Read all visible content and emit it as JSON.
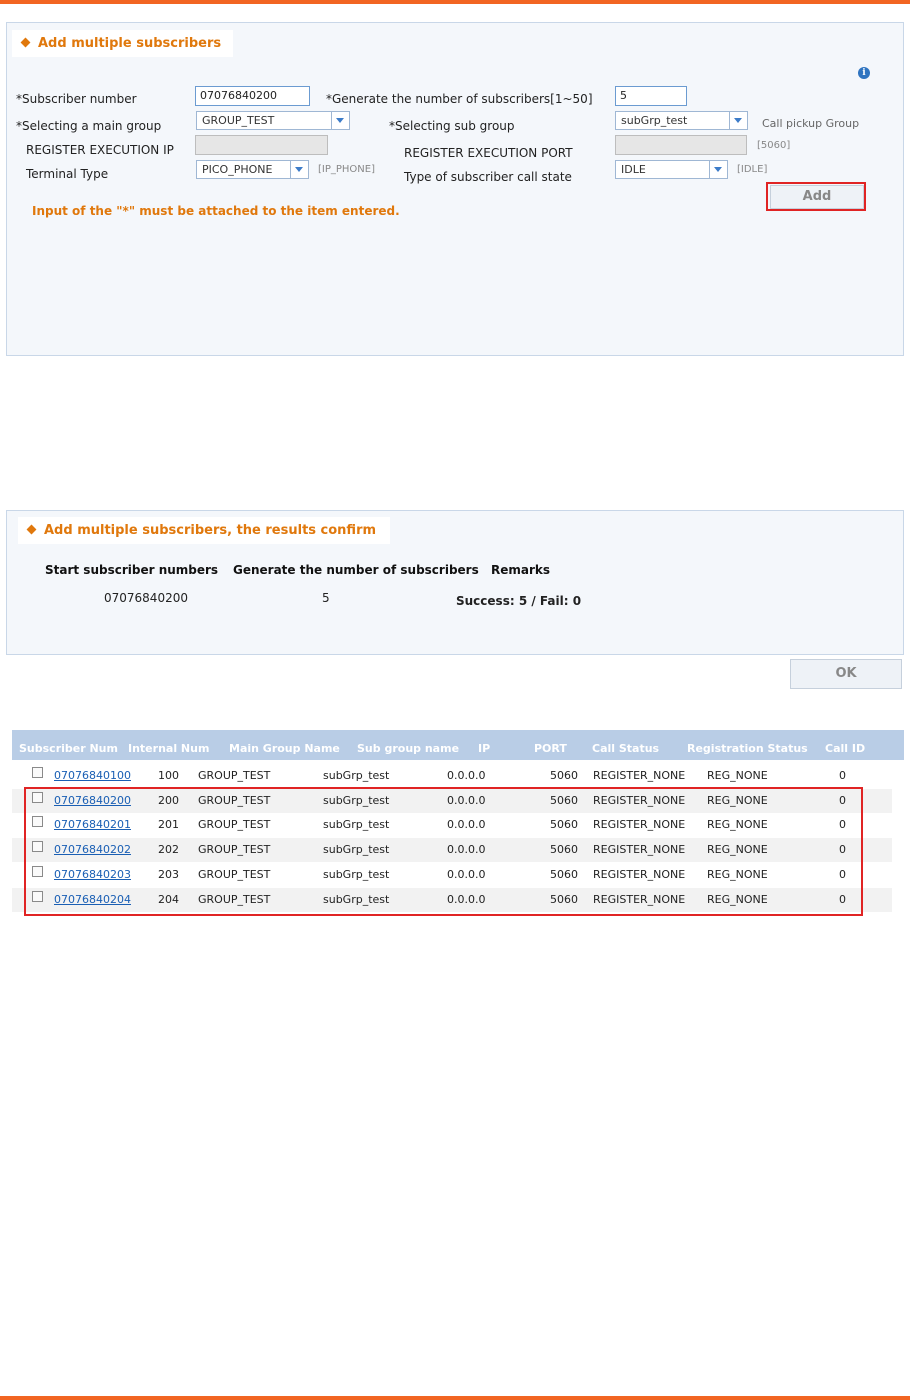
{
  "form": {
    "title": "Add multiple subscribers",
    "subscriber_number_label": "*Subscriber number",
    "subscriber_number_value": "07076840200",
    "generate_count_label": "*Generate the number of subscribers[1~50]",
    "generate_count_value": "5",
    "main_group_label": "*Selecting a main group",
    "main_group_value": "GROUP_TEST",
    "sub_group_label": "*Selecting sub group",
    "sub_group_value": "subGrp_test",
    "call_pickup_label": "Call pickup Group",
    "register_ip_label": "REGISTER EXECUTION IP",
    "register_port_label": "REGISTER EXECUTION PORT",
    "register_port_hint": "[5060]",
    "terminal_type_label": "Terminal Type",
    "terminal_type_value": "PICO_PHONE",
    "terminal_type_hint": "[IP_PHONE]",
    "call_state_label": "Type of subscriber call state",
    "call_state_value": "IDLE",
    "call_state_hint": "[IDLE]",
    "add_button": "Add",
    "note": "Input of the \"*\" must be attached to the item entered.",
    "info_icon": "i"
  },
  "result": {
    "title": "Add multiple subscribers, the results confirm",
    "headers": [
      "Start subscriber numbers",
      "Generate the number of subscribers",
      "Remarks"
    ],
    "start_number": "07076840200",
    "count": "5",
    "remarks": "Success: 5 / Fail: 0",
    "ok_button": "OK"
  },
  "table": {
    "columns": [
      "Subscriber Num",
      "Internal Num",
      "Main Group Name",
      "Sub group name",
      "IP",
      "PORT",
      "Call Status",
      "Registration Status",
      "Call ID"
    ],
    "rows": [
      [
        "07076840100",
        "100",
        "GROUP_TEST",
        "subGrp_test",
        "0.0.0.0",
        "5060",
        "REGISTER_NONE",
        "REG_NONE",
        "0"
      ],
      [
        "07076840200",
        "200",
        "GROUP_TEST",
        "subGrp_test",
        "0.0.0.0",
        "5060",
        "REGISTER_NONE",
        "REG_NONE",
        "0"
      ],
      [
        "07076840201",
        "201",
        "GROUP_TEST",
        "subGrp_test",
        "0.0.0.0",
        "5060",
        "REGISTER_NONE",
        "REG_NONE",
        "0"
      ],
      [
        "07076840202",
        "202",
        "GROUP_TEST",
        "subGrp_test",
        "0.0.0.0",
        "5060",
        "REGISTER_NONE",
        "REG_NONE",
        "0"
      ],
      [
        "07076840203",
        "203",
        "GROUP_TEST",
        "subGrp_test",
        "0.0.0.0",
        "5060",
        "REGISTER_NONE",
        "REG_NONE",
        "0"
      ],
      [
        "07076840204",
        "204",
        "GROUP_TEST",
        "subGrp_test",
        "0.0.0.0",
        "5060",
        "REGISTER_NONE",
        "REG_NONE",
        "0"
      ]
    ]
  },
  "colors": {
    "accent": "#f26522",
    "title": "#e0780c",
    "highlight": "#e02424",
    "table_header": "#b9cde6",
    "link": "#1a5fb4"
  }
}
